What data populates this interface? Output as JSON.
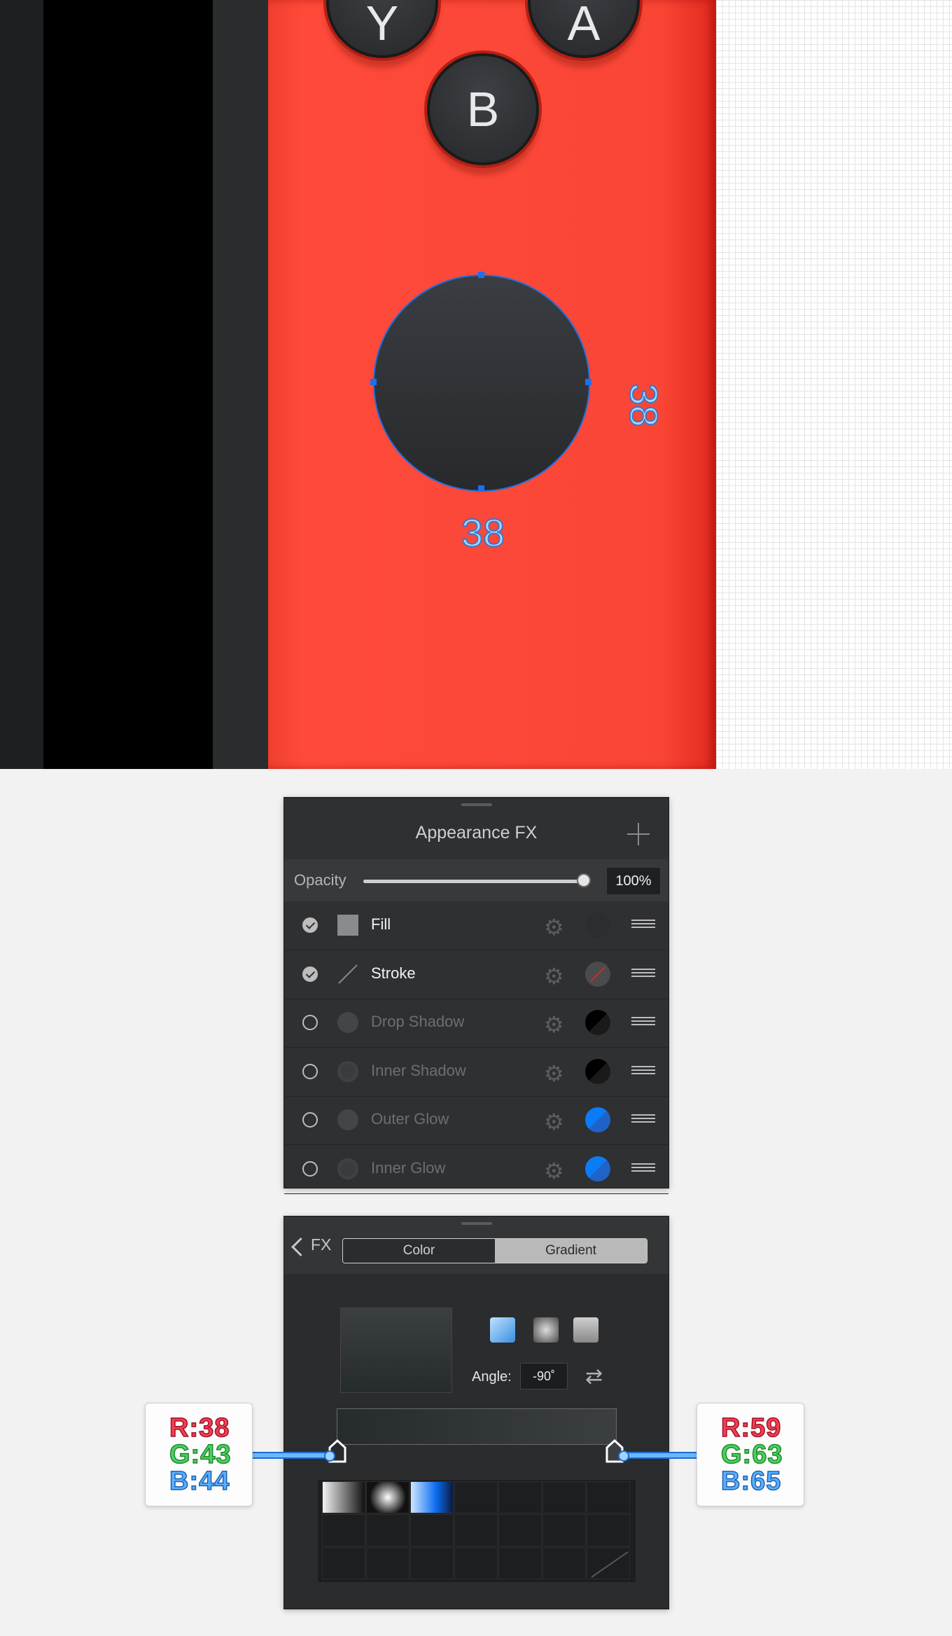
{
  "canvas": {
    "buttons": {
      "y": "Y",
      "a": "A",
      "b": "B"
    },
    "dimensions": {
      "width": "38",
      "height": "38"
    },
    "colors": {
      "device": "#fb4838",
      "stick": "#2f3235",
      "selection": "#1e6ff0"
    }
  },
  "appearance": {
    "title": "Appearance FX",
    "opacity_label": "Opacity",
    "opacity_value": "100%",
    "opacity_level": 1.0,
    "effects": [
      {
        "label": "Fill",
        "enabled": true,
        "swatch": "#2c2d2f",
        "icon": "fill-square-icon"
      },
      {
        "label": "Stroke",
        "enabled": true,
        "swatch": "none",
        "icon": "stroke-line-icon"
      },
      {
        "label": "Drop Shadow",
        "enabled": false,
        "swatch": "#000000",
        "icon": "drop-shadow-icon"
      },
      {
        "label": "Inner Shadow",
        "enabled": false,
        "swatch": "#000000",
        "icon": "inner-shadow-icon"
      },
      {
        "label": "Outer Glow",
        "enabled": false,
        "swatch": "#0a7cf5",
        "icon": "outer-glow-icon"
      },
      {
        "label": "Inner Glow",
        "enabled": false,
        "swatch": "#0a7cf5",
        "icon": "inner-glow-icon"
      }
    ]
  },
  "gradient_panel": {
    "back_label": "FX",
    "tabs": {
      "color": "Color",
      "gradient": "Gradient"
    },
    "selected_tab": "Gradient",
    "angle_label": "Angle:",
    "angle_value": "-90˚",
    "stops": [
      {
        "r": "R:38",
        "g": "G:43",
        "b": "B:44",
        "color": "#262b2c"
      },
      {
        "r": "R:59",
        "g": "G:63",
        "b": "B:65",
        "color": "#3b3f41"
      }
    ]
  }
}
